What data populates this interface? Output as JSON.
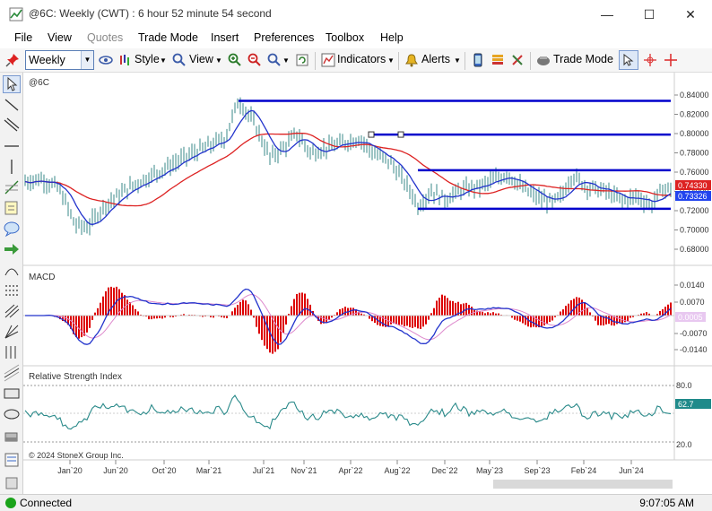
{
  "window": {
    "title": "@6C: Weekly (CWT) : 6 hour 52 minute 54 second",
    "minimize": "—",
    "maximize": "☐",
    "close": "✕"
  },
  "menu": [
    "File",
    "View",
    "Quotes",
    "Trade Mode",
    "Insert",
    "Preferences",
    "Toolbox",
    "Help"
  ],
  "toolbar": {
    "period": "Weekly",
    "style_label": "Style",
    "view_label": "View",
    "indicators_label": "Indicators",
    "alerts_label": "Alerts",
    "trade_mode_label": "Trade Mode"
  },
  "colors": {
    "price_bar": "#3a8a8a",
    "ma_fast": "#2233cc",
    "ma_slow": "#dd2222",
    "hline": "#0000cc",
    "macd_line": "#2233cc",
    "signal_line": "#dd88cc",
    "hist": "#dd0000",
    "rsi": "#2a8a8a",
    "price_tag_red": "#dd2222",
    "price_tag_blue": "#2244ee",
    "rsi_tag": "#1f8a8a"
  },
  "chart": {
    "symbol_label": "@6C",
    "price_ticks": [
      "0.84000",
      "0.82000",
      "0.80000",
      "0.78000",
      "0.76000",
      "0.74000",
      "0.72000",
      "0.70000",
      "0.68000"
    ],
    "price_tag_red": "0.74330",
    "price_tag_blue": "0.73326",
    "macd_label": "MACD",
    "macd_ticks": [
      "0.0140",
      "0.0070",
      "-0.0070",
      "-0.0140"
    ],
    "macd_tag": "0.0005",
    "rsi_label": "Relative Strength Index",
    "rsi_ticks": [
      "80.0",
      "20.0"
    ],
    "rsi_tag": "62.7",
    "copyright": "© 2024 StoneX Group Inc.",
    "x_labels": [
      "Jan`20",
      "Jun`20",
      "Oct`20",
      "Mar`21",
      "Jul`21",
      "Nov`21",
      "Apr`22",
      "Aug`22",
      "Dec`22",
      "May`23",
      "Sep`23",
      "Feb`24",
      "Jun`24"
    ]
  },
  "status": {
    "connection": "Connected",
    "time": "9:07:05 AM"
  }
}
